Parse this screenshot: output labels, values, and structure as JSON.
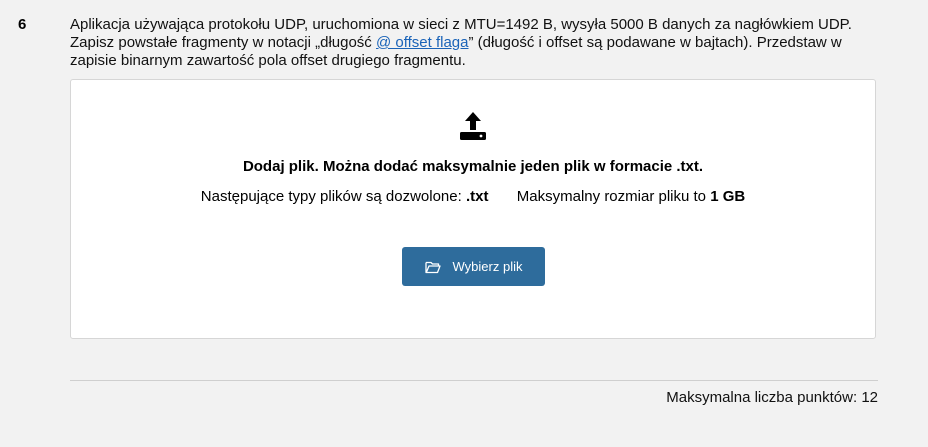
{
  "question": {
    "number": "6",
    "text_before_link": "Aplikacja używająca protokołu UDP, uruchomiona w sieci z MTU=1492 B, wysyła 5000 B danych za nagłówkiem UDP. Zapisz powstałe fragmenty w notacji „długość ",
    "link_text": "@ offset flaga",
    "text_after_link": "” (długość i offset są podawane w bajtach). Przedstaw w zapisie binarnym zawartość pola offset drugiego fragmentu."
  },
  "upload": {
    "icon": "upload-icon",
    "title": "Dodaj plik. Można dodać maksymalnie jeden plik w formacie .txt.",
    "allowed_types_label": "Następujące typy plików są dozwolone:",
    "allowed_types_value": ".txt",
    "max_size_label": "Maksymalny rozmiar pliku to",
    "max_size_value": "1 GB",
    "button_icon": "folder-open-icon",
    "button_label": "Wybierz plik"
  },
  "footer": {
    "max_points": "Maksymalna liczba punktów: 12"
  },
  "colors": {
    "button_bg": "#2e6c9c",
    "link": "#1a63b8",
    "page_bg": "#f2f2f2"
  }
}
